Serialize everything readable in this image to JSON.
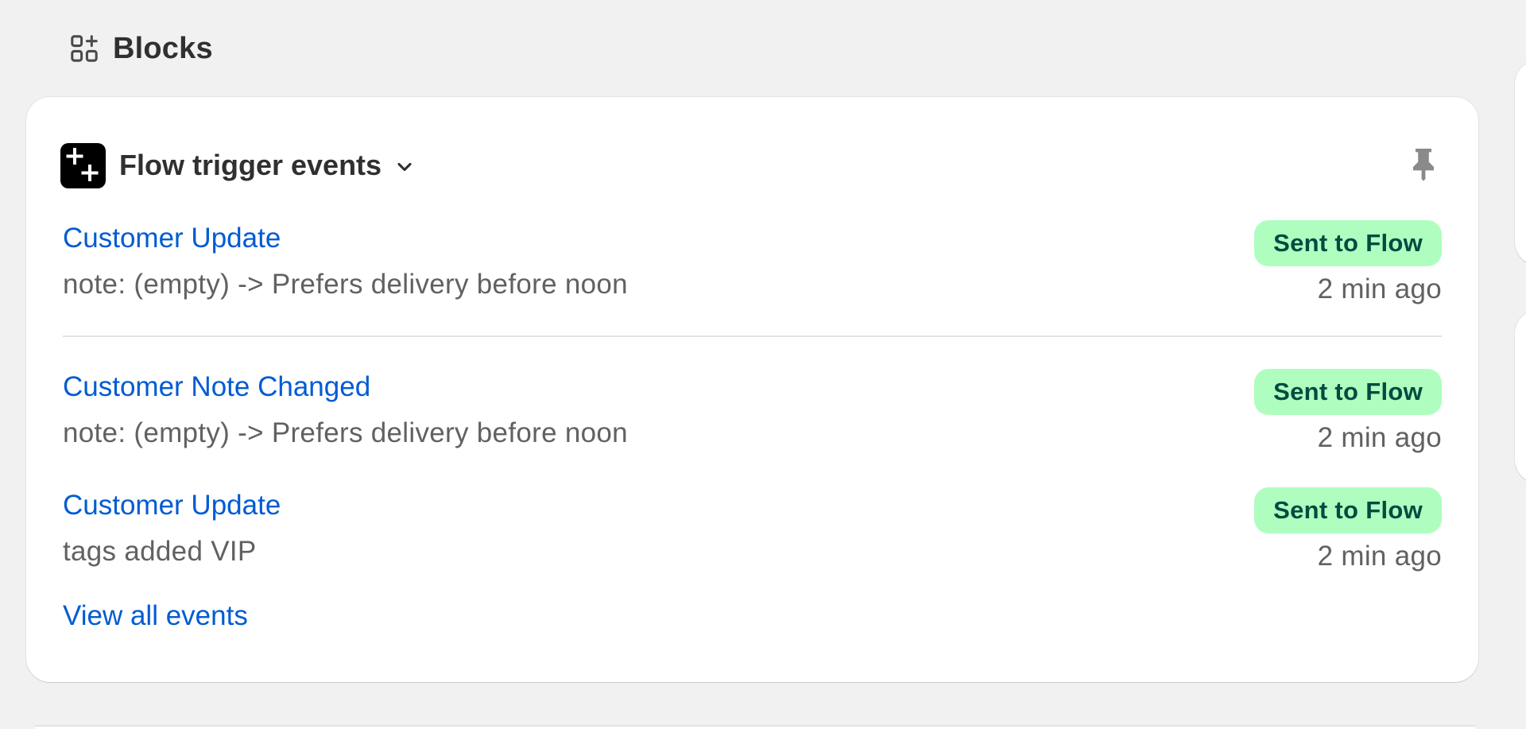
{
  "section": {
    "title": "Blocks",
    "icon": "blocks-icon"
  },
  "card": {
    "title": "Flow trigger events",
    "app_icon": "flow-app-icon",
    "chevron_icon": "chevron-down-icon",
    "pin_icon": "pin-icon",
    "events": [
      {
        "title": "Customer Update",
        "detail": "note: (empty) -> Prefers delivery before noon",
        "status": "Sent to Flow",
        "time": "2 min ago"
      },
      {
        "title": "Customer Note Changed",
        "detail": "note: (empty) -> Prefers delivery before noon",
        "status": "Sent to Flow",
        "time": "2 min ago"
      },
      {
        "title": "Customer Update",
        "detail": "tags added VIP",
        "status": "Sent to Flow",
        "time": "2 min ago"
      }
    ],
    "view_all_label": "View all events"
  },
  "colors": {
    "link": "#005bd3",
    "badge_bg": "#affebf",
    "badge_text": "#014b40",
    "page_bg": "#f1f1f1"
  }
}
